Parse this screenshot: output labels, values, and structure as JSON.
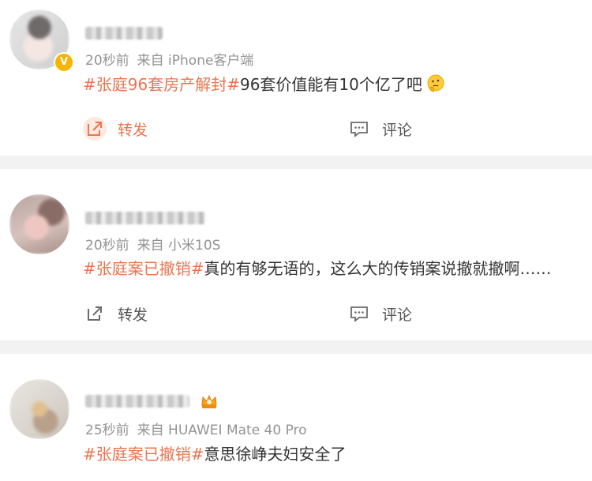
{
  "posts": [
    {
      "time": "20秒前",
      "source": "来自 iPhone客户端",
      "hashtag": "#张庭96套房产解封#",
      "text": "96套价值能有10个亿了吧",
      "verified_badge": "V",
      "emoji": "thinking-face",
      "repost_label": "转发",
      "comment_label": "评论",
      "repost_active": true
    },
    {
      "time": "20秒前",
      "source": "来自 小米10S",
      "hashtag": "#张庭案已撤销#",
      "text": "真的有够无语的，这么大的传销案说撤就撤啊……",
      "repost_label": "转发",
      "comment_label": "评论",
      "repost_active": false
    },
    {
      "time": "25秒前",
      "source": "来自 HUAWEI Mate 40 Pro",
      "hashtag": "#张庭案已撤销#",
      "text": "意思徐峥夫妇安全了",
      "member_badge": "crown-icon"
    }
  ],
  "colors": {
    "hashtag": "#eb7350",
    "meta": "#939393",
    "text": "#333333",
    "separator": "#f2f2f2",
    "verified": "#f7b500"
  }
}
